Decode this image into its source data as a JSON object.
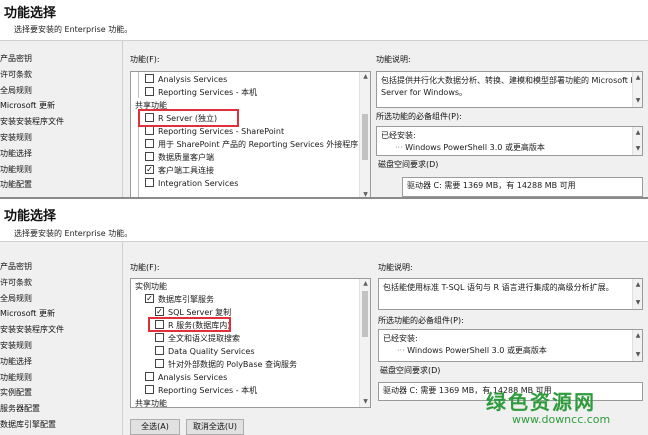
{
  "top": {
    "title": "功能选择",
    "subtitle": "选择要安装的 Enterprise 功能。",
    "nav": [
      "产品密钥",
      "许可条款",
      "全局规则",
      "Microsoft 更新",
      "安装安装程序文件",
      "安装规则",
      "功能选择",
      "功能规则",
      "功能配置"
    ],
    "features_label": "功能(F):",
    "features": [
      {
        "label": "Analysis Services",
        "checked": false
      },
      {
        "label": "Reporting Services - 本机",
        "checked": false
      },
      {
        "label": "共享功能",
        "group": true
      },
      {
        "label": "R Server (独立)",
        "checked": false,
        "highlight": true
      },
      {
        "label": "Reporting Services - SharePoint",
        "checked": false
      },
      {
        "label": "用于 SharePoint 产品的 Reporting Services 外接程序",
        "checked": false
      },
      {
        "label": "数据质量客户端",
        "checked": false
      },
      {
        "label": "客户端工具连接",
        "checked": true
      },
      {
        "label": "Integration Services",
        "checked": false
      }
    ],
    "desc_label": "功能说明:",
    "desc_text": "包括提供并行化大数据分析、转换、建模和模型部署功能的 Microsoft R Server for Windows。",
    "prereq_label": "所选功能的必备组件(P):",
    "prereq_installed": "已经安装:",
    "prereq_item": "Windows PowerShell 3.0 或更高版本",
    "disk_label": "磁盘空间要求(D)",
    "disk_text": "驱动器 C: 需要 1369 MB，有 14288 MB 可用"
  },
  "bottom": {
    "title": "功能选择",
    "subtitle": "选择要安装的 Enterprise 功能。",
    "nav": [
      "产品密钥",
      "许可条款",
      "全局规则",
      "Microsoft 更新",
      "安装安装程序文件",
      "安装规则",
      "功能选择",
      "功能规则",
      "实例配置",
      "服务器配置",
      "数据库引擎配置",
      "功能配置规则"
    ],
    "features_label": "功能(F):",
    "features": [
      {
        "label": "实例功能",
        "group": true
      },
      {
        "label": "数据库引擎服务",
        "checked": true,
        "indent": 1
      },
      {
        "label": "SQL Server 复制",
        "checked": true,
        "indent": 2
      },
      {
        "label": "R 服务(数据库内)",
        "checked": false,
        "indent": 2,
        "highlight": true
      },
      {
        "label": "全文和语义提取搜索",
        "checked": false,
        "indent": 2
      },
      {
        "label": "Data Quality Services",
        "checked": false,
        "indent": 2
      },
      {
        "label": "针对外部数据的 PolyBase 查询服务",
        "checked": false,
        "indent": 2
      },
      {
        "label": "Analysis Services",
        "checked": false,
        "indent": 1
      },
      {
        "label": "Reporting Services - 本机",
        "checked": false,
        "indent": 1
      },
      {
        "label": "共享功能",
        "group": true
      }
    ],
    "desc_label": "功能说明:",
    "desc_text": "包括能使用标准 T-SQL 语句与 R 语言进行集成的高级分析扩展。",
    "prereq_label": "所选功能的必备组件(P):",
    "prereq_installed": "已经安装:",
    "prereq_item": "Windows PowerShell 3.0 或更高版本",
    "disk_label": "磁盘空间要求(D)",
    "disk_text": "驱动器 C: 需要 1369 MB，有 14288 MB 可用",
    "select_all": "全选(A)",
    "deselect_all": "取消全选(U)"
  },
  "watermark": {
    "text": "绿色资源网",
    "url": "www.downcc.com",
    "color": "#2e9c3c"
  }
}
